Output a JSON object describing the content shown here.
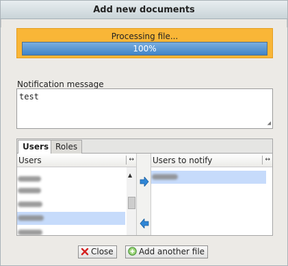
{
  "dialog": {
    "title": "Add new documents"
  },
  "progress": {
    "label": "Processing file...",
    "percent_text": "100%",
    "value": 100
  },
  "notification": {
    "label": "Notification message",
    "value": "test"
  },
  "tabs": [
    {
      "label": "Users",
      "active": true
    },
    {
      "label": "Roles",
      "active": false
    }
  ],
  "available_list": {
    "header": "Users",
    "rows": [
      {
        "redacted": true,
        "selected": false
      },
      {
        "redacted": true,
        "selected": false
      },
      {
        "redacted": true,
        "selected": false
      },
      {
        "redacted": true,
        "selected": true
      },
      {
        "redacted": true,
        "selected": false
      }
    ]
  },
  "notify_list": {
    "header": "Users to notify",
    "rows": [
      {
        "redacted": true,
        "selected": true
      }
    ]
  },
  "buttons": {
    "close_label": "Close",
    "add_another_label": "Add another file"
  },
  "icons": {
    "close": "close-x-icon",
    "add": "add-plus-icon",
    "move_right": "arrow-right-icon",
    "move_left": "arrow-left-icon",
    "column_resize": "column-resize-icon"
  },
  "colors": {
    "progress_panel": "#f9b637",
    "progress_fill": "#4a8ad0",
    "selection": "#c6dbfb",
    "arrow_blue": "#2f86d6"
  }
}
